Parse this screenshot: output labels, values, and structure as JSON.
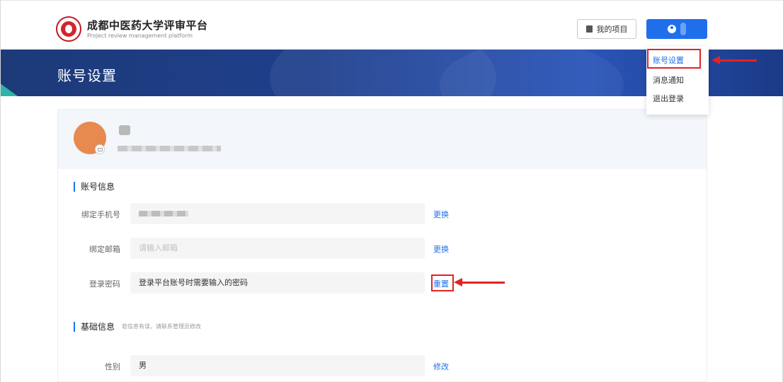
{
  "header": {
    "brand_title": "成都中医药大学评审平台",
    "brand_subtitle": "Project review management platform",
    "my_project_label": "我的项目"
  },
  "banner": {
    "title": "账号设置"
  },
  "dropdown": {
    "items": [
      {
        "label": "账号设置",
        "active": true
      },
      {
        "label": "消息通知",
        "active": false
      },
      {
        "label": "退出登录",
        "active": false
      }
    ]
  },
  "account_section": {
    "title": "账号信息",
    "rows": [
      {
        "label": "绑定手机号",
        "value": "",
        "placeholder": "",
        "action": "更换"
      },
      {
        "label": "绑定邮箱",
        "value": "",
        "placeholder": "请输入邮箱",
        "action": "更换"
      },
      {
        "label": "登录密码",
        "value": "登录平台账号时需要输入的密码",
        "placeholder": "",
        "action": "重置"
      }
    ]
  },
  "basic_section": {
    "title": "基础信息",
    "note": "若信息有误，请联系管理员修改",
    "rows": [
      {
        "label": "性别",
        "value": "男",
        "action": "修改"
      }
    ]
  },
  "colors": {
    "accent": "#1f6feb",
    "highlight": "#e02424",
    "banner": "#1e3f8c",
    "avatar": "#e68a4f"
  },
  "icons": [
    "logo-icon",
    "book-icon",
    "user-icon",
    "camera-icon"
  ]
}
